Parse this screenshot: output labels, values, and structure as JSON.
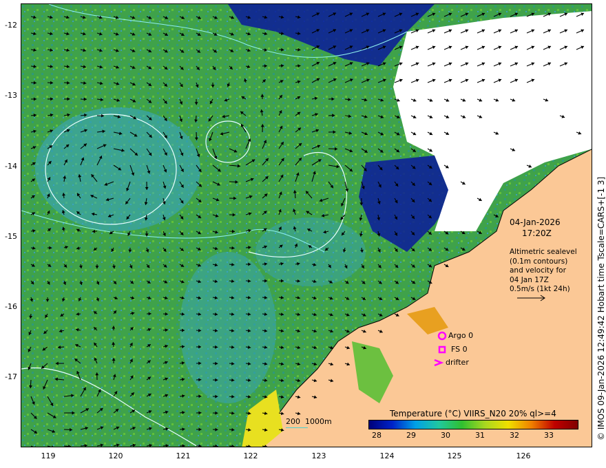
{
  "map": {
    "date": "04-Jan-2026",
    "time": "17:20Z",
    "description_lines": [
      "Altimetric sealevel",
      "(0.1m contours)",
      "and velocity for",
      "04 Jan 17Z",
      "0.5m/s (1kt 24h)"
    ],
    "legend": {
      "argo": "Argo 0",
      "fs": "FS 0",
      "drifter": "drifter",
      "scale_label": "200  1000m"
    },
    "colorbar": {
      "title": "Temperature (°C) VIIRS_N20 20% ql>=4",
      "ticks": [
        "28",
        "29",
        "30",
        "31",
        "32",
        "33"
      ],
      "colors": [
        "#00007a",
        "#0022c8",
        "#00a0e6",
        "#20c8a0",
        "#30c030",
        "#a8d820",
        "#f0e000",
        "#f08000",
        "#c00000",
        "#800000"
      ]
    },
    "axes": {
      "y_ticks": [
        "-12",
        "-13",
        "-14",
        "-15",
        "-16",
        "-17"
      ],
      "x_ticks": [
        "119",
        "120",
        "121",
        "122",
        "123",
        "124",
        "125",
        "126"
      ]
    },
    "copyright": "© IMOS 09-Jan-2026 12:49:42 Hobart time Tscale=CARS+[-1 3]",
    "colors": {
      "land": "#fbc896",
      "ocean_green": "#3fa24a",
      "cloud": "#ffffff",
      "contour": "#8ff0f0",
      "marker": "#ff00ff"
    }
  }
}
